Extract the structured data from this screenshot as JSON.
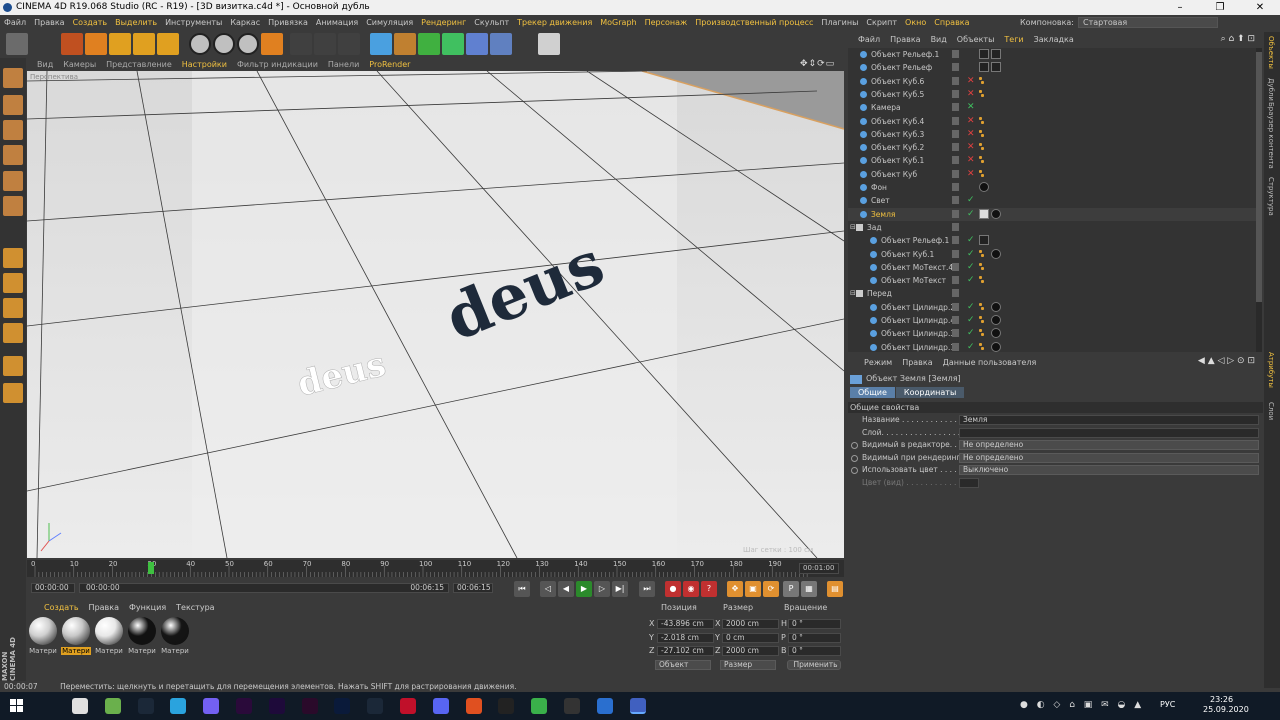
{
  "window": {
    "title": "CINEMA 4D R19.068 Studio (RC - R19) - [3D визитка.c4d *] - Основной дубль"
  },
  "menubar": {
    "items": [
      "Файл",
      "Правка",
      "Создать",
      "Выделить",
      "Инструменты",
      "Каркас",
      "Привязка",
      "Анимация",
      "Симуляция",
      "Рендеринг",
      "Скульпт",
      "Трекер движения",
      "MoGraph",
      "Персонаж",
      "Производственный процесс",
      "Плагины",
      "Скрипт",
      "Окно",
      "Справка"
    ],
    "layout_label": "Компоновка:",
    "layout_value": "Стартовая"
  },
  "toolbar": {
    "icons": [
      "undo-icon",
      "select-icon",
      "move-icon",
      "scale-icon",
      "rotate-icon",
      "live-select-icon",
      "x-axis-icon",
      "y-axis-icon",
      "z-axis-icon",
      "world-coord-icon",
      "render-view-icon",
      "render-picture-icon",
      "render-settings-icon",
      "cube-icon",
      "pen-icon",
      "subdivision-icon",
      "cloner-icon",
      "deformer-icon",
      "floor-icon",
      "light-icon"
    ]
  },
  "viewport": {
    "menu": [
      "Вид",
      "Камеры",
      "Представление",
      "Настройки",
      "Фильтр индикации",
      "Панели",
      "ProRender"
    ],
    "perspective_label": "Перспектива",
    "grid_label": "Шаг сетки : 100 см",
    "logo_text": "deus"
  },
  "timeline": {
    "ticks": [
      "0",
      "10",
      "20",
      "30",
      "40",
      "50",
      "60",
      "70",
      "80",
      "90",
      "100",
      "110",
      "120",
      "130",
      "140",
      "150",
      "160",
      "170",
      "180",
      "190"
    ],
    "end": "00:01:00",
    "current_frame_marker": 30
  },
  "transport": {
    "start": "00:00:00",
    "range_start": "00:00:00",
    "range_end": "00:06:15",
    "end": "00:06:15"
  },
  "materials": {
    "menu": [
      "Создать",
      "Правка",
      "Функция",
      "Текстура"
    ],
    "items": [
      "Матери",
      "Матери",
      "Матери",
      "Матери",
      "Матери"
    ],
    "brand": "MAXON CINEMA 4D"
  },
  "coords": {
    "headers": [
      "Позиция",
      "Размер",
      "Вращение"
    ],
    "rows": [
      {
        "axis": "X",
        "pos": "-43.896 cm",
        "size": "2000 cm",
        "rot_label": "H",
        "rot": "0 °"
      },
      {
        "axis": "Y",
        "pos": "-2.018 cm",
        "size": "0 cm",
        "rot_label": "P",
        "rot": "0 °"
      },
      {
        "axis": "Z",
        "pos": "-27.102 cm",
        "size": "2000 cm",
        "rot_label": "B",
        "rot": "0 °"
      }
    ],
    "mode1": "Объект",
    "mode2": "Размер",
    "apply": "Применить"
  },
  "status": {
    "time": "00:00:07",
    "text": "Переместить: щелкнуть и перетащить для перемещения элементов. Нажать SHIFT для растрирования движения."
  },
  "objects": {
    "menu": [
      "Файл",
      "Правка",
      "Вид",
      "Объекты",
      "Теги",
      "Закладка"
    ],
    "rows": [
      {
        "name": "Объект Рельеф.1",
        "indent": 0
      },
      {
        "name": "Объект Рельеф",
        "indent": 0
      },
      {
        "name": "Объект Куб.6",
        "indent": 0
      },
      {
        "name": "Объект Куб.5",
        "indent": 0
      },
      {
        "name": "Камера",
        "indent": 0
      },
      {
        "name": "Объект Куб.4",
        "indent": 0
      },
      {
        "name": "Объект Куб.3",
        "indent": 0
      },
      {
        "name": "Объект Куб.2",
        "indent": 0
      },
      {
        "name": "Объект Куб.1",
        "indent": 0
      },
      {
        "name": "Объект Куб",
        "indent": 0
      },
      {
        "name": "Фон",
        "indent": 0
      },
      {
        "name": "Свет",
        "indent": 0
      },
      {
        "name": "Земля",
        "indent": 0,
        "selected": true
      },
      {
        "name": "Зад",
        "indent": -1
      },
      {
        "name": "Объект Рельеф.1",
        "indent": 1
      },
      {
        "name": "Объект Куб.1",
        "indent": 1
      },
      {
        "name": "Объект МоТекст.4",
        "indent": 1
      },
      {
        "name": "Объект МоТекст",
        "indent": 1
      },
      {
        "name": "Перед",
        "indent": -1
      },
      {
        "name": "Объект Цилиндр.2",
        "indent": 1
      },
      {
        "name": "Объект Цилиндр.4",
        "indent": 1
      },
      {
        "name": "Объект Цилиндр.3",
        "indent": 1
      },
      {
        "name": "Объект Цилиндр.1",
        "indent": 1
      }
    ]
  },
  "attributes": {
    "menu": [
      "Режим",
      "Правка",
      "Данные пользователя"
    ],
    "object_title": "Объект Земля [Земля]",
    "tabs": [
      "Общие",
      "Координаты"
    ],
    "section": "Общие свойства",
    "props": [
      {
        "label": "Название . . . . . . . . . . . . . .",
        "value": "Земля"
      },
      {
        "label": "Слой. . . . . . . . . . . . . . . . . .",
        "value": ""
      },
      {
        "label": "Видимый в редакторе. . . .",
        "value": "Не определено"
      },
      {
        "label": "Видимый при рендеринге",
        "value": "Не определено"
      },
      {
        "label": "Использовать цвет . . . . . .",
        "value": "Выключено"
      },
      {
        "label": "Цвет (вид) . . . . . . . . . . . .",
        "value": ""
      }
    ]
  },
  "right_tabs": [
    "Объекты",
    "Дубли",
    "Браузер контента",
    "Структура",
    "Атрибуты",
    "Слои"
  ],
  "taskbar": {
    "time": "23:26",
    "date": "25.09.2020",
    "lang": "РУС"
  }
}
